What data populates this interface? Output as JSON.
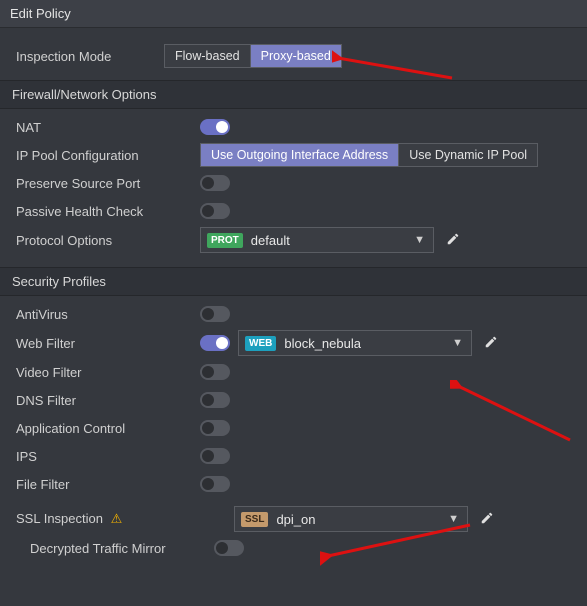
{
  "window": {
    "title": "Edit Policy"
  },
  "inspection": {
    "label": "Inspection Mode",
    "options": {
      "flow": "Flow-based",
      "proxy": "Proxy-based"
    },
    "selected": "proxy"
  },
  "sections": {
    "firewall": "Firewall/Network Options",
    "security": "Security Profiles"
  },
  "firewall": {
    "nat": {
      "label": "NAT",
      "on": true
    },
    "ippool": {
      "label": "IP Pool Configuration",
      "options": {
        "outgoing": "Use Outgoing Interface Address",
        "dynamic": "Use Dynamic IP Pool"
      },
      "selected": "outgoing"
    },
    "preserve_port": {
      "label": "Preserve Source Port",
      "on": false
    },
    "passive_hc": {
      "label": "Passive Health Check",
      "on": false
    },
    "protocol": {
      "label": "Protocol Options",
      "tag": "PROT",
      "value": "default"
    }
  },
  "security": {
    "antivirus": {
      "label": "AntiVirus",
      "on": false
    },
    "webfilter": {
      "label": "Web Filter",
      "on": true,
      "tag": "WEB",
      "value": "block_nebula"
    },
    "videofilter": {
      "label": "Video Filter",
      "on": false
    },
    "dnsfilter": {
      "label": "DNS Filter",
      "on": false
    },
    "appcontrol": {
      "label": "Application Control",
      "on": false
    },
    "ips": {
      "label": "IPS",
      "on": false
    },
    "filefilter": {
      "label": "File Filter",
      "on": false
    },
    "ssl": {
      "label": "SSL Inspection",
      "tag": "SSL",
      "value": "dpi_on",
      "warning": true
    },
    "decrypt_mirror": {
      "label": "Decrypted Traffic Mirror",
      "on": false
    }
  }
}
